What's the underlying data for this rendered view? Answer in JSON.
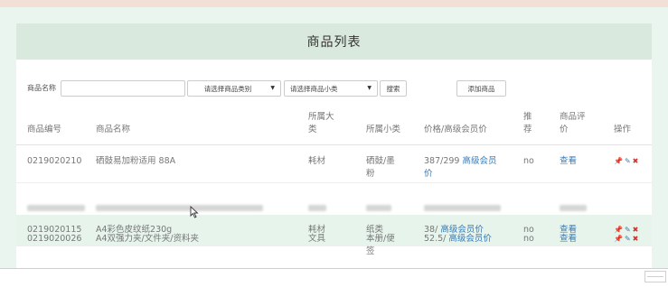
{
  "panel": {
    "title": "商品列表"
  },
  "filters": {
    "name_label": "商品名称",
    "name_value": "",
    "category_select": "请选择商品类别",
    "subcategory_select": "请选择商品小类",
    "search_button": "搜索",
    "add_button": "添加商品"
  },
  "table": {
    "headers": {
      "code": "商品编号",
      "name": "商品名称",
      "category_line1": "所属大",
      "category_line2": "类",
      "subcategory": "所属小类",
      "price": "价格/高级会员价",
      "recommend_line1": "推",
      "recommend_line2": "荐",
      "review_line1": "商品评",
      "review_line2": "价",
      "ops": "操作"
    },
    "rows": [
      {
        "code": "0219020210",
        "name": "硒鼓易加粉适用 88A",
        "category": "耗材",
        "subcategory_line1": "硒鼓/墨",
        "subcategory_line2": "粉",
        "price_line1": "387/299 ",
        "price_link": "高级会员",
        "price_line2": "价",
        "recommend": "no",
        "review": "查看"
      },
      {
        "code": "0219020115",
        "name": "A4彩色皮纹纸230g",
        "category": "耗材",
        "subcategory_line1": "纸类",
        "subcategory_line2": "",
        "price_line1": "38/ ",
        "price_link": "高级会员价",
        "price_line2": "",
        "recommend": "no",
        "review": "查看"
      },
      {
        "code": "0219020026",
        "name": "A4双强力夹/文件夹/资料夹",
        "category": "文具",
        "subcategory_line1": "本册/便",
        "subcategory_line2": "签",
        "price_line1": "52.5/ ",
        "price_link": "高级会员价",
        "price_line2": "",
        "recommend": "no",
        "review": "查看"
      }
    ]
  },
  "icons": {
    "edit": "thumbtack-icon",
    "pen": "pencil-icon",
    "delete": "close-icon"
  },
  "colors": {
    "header_bg": "#d9e9dd",
    "page_bg": "#e9f5ee",
    "link": "#3a79b5",
    "delete": "#d0312d"
  }
}
